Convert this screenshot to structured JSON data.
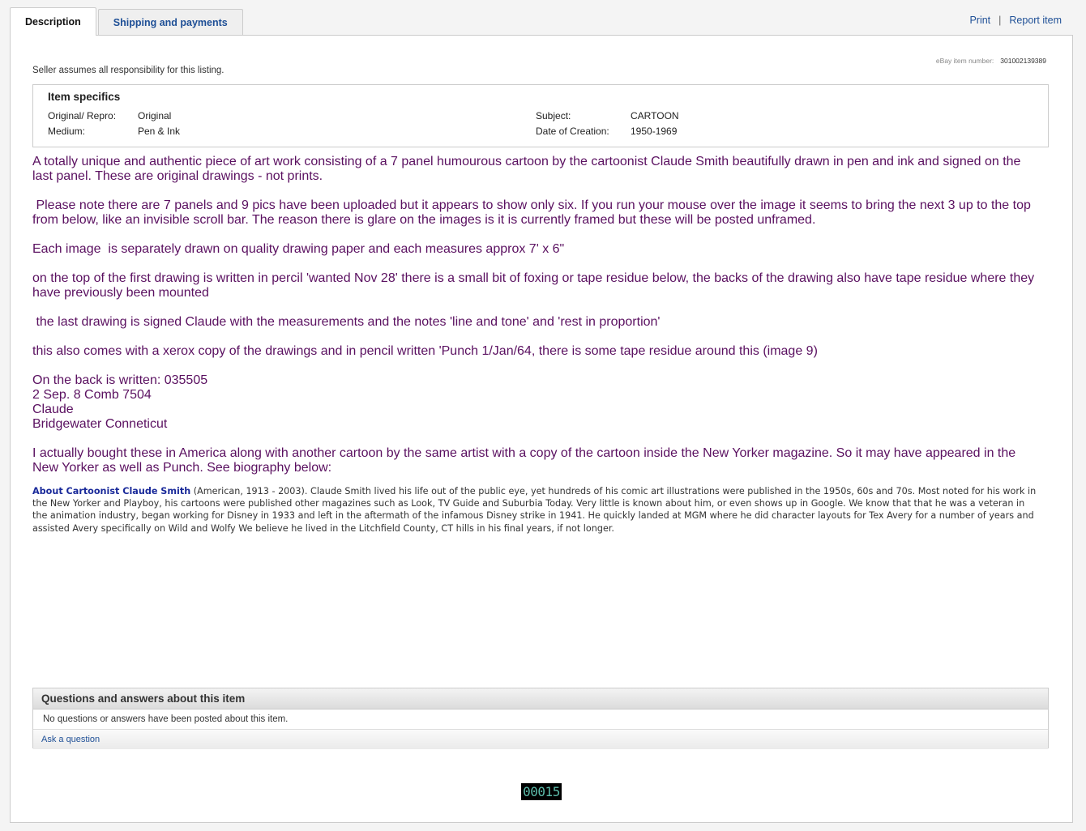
{
  "tabs": [
    {
      "label": "Description"
    },
    {
      "label": "Shipping and payments"
    }
  ],
  "toplinks": {
    "print": "Print",
    "separator": "|",
    "report": "Report item"
  },
  "item_number": {
    "label": "eBay item number:",
    "value": "301002139389"
  },
  "seller_note": "Seller assumes all responsibility for this listing.",
  "specifics": {
    "title": "Item specifics",
    "rows": [
      {
        "key": "Original/ Repro:",
        "value": "Original"
      },
      {
        "key": "Medium:",
        "value": "Pen & Ink"
      },
      {
        "key": "Subject:",
        "value": "CARTOON"
      },
      {
        "key": "Date of Creation:",
        "value": "1950-1969"
      }
    ]
  },
  "description": [
    "A totally unique and authentic piece of art work consisting of a 7 panel humourous cartoon by the cartoonist Claude Smith beautifully drawn in pen and ink and signed on the last panel. These are original drawings - not prints.",
    " Please note there are 7 panels and 9 pics have been uploaded but it appears to show only six. If you run your mouse over the image it seems to bring the next 3 up to the top from below, like an invisible scroll bar. The reason there is glare on the images is it is currently framed but these will be posted unframed.",
    "Each image  is separately drawn on quality drawing paper and each measures approx 7' x 6\"",
    "on the top of the first drawing is written in percil 'wanted Nov 28' there is a small bit of foxing or tape residue below, the backs of the drawing also have tape residue where they have previously been mounted",
    " the last drawing is signed Claude with the measurements and the notes 'line and tone' and 'rest in proportion'",
    "this also comes with a xerox copy of the drawings and in pencil written 'Punch 1/Jan/64, there is some tape residue around this (image 9)",
    "On the back is written: 035505",
    "2 Sep. 8 Comb 7504",
    "Claude",
    "Bridgewater Conneticut",
    "I actually bought these in America along with another cartoon by the same artist with a copy of the cartoon inside the New Yorker magazine. So it may have appeared in the New Yorker as well as Punch. See biography below:"
  ],
  "bio": {
    "name": "About Cartoonist Claude Smith",
    "text": " (American, 1913 - 2003). Claude Smith lived his life out of the public eye, yet hundreds of his comic art illustrations were published in the 1950s, 60s and 70s. Most noted for his work in the New Yorker and Playboy, his cartoons were published other magazines such as Look, TV Guide and Suburbia Today.  Very little is known about him, or even shows up in Google.  We know that that he was a veteran in the animation industry, began working for Disney in 1933 and left in the aftermath of the infamous Disney strike in 1941. He quickly landed at MGM where he did character layouts for Tex Avery for a number of years and assisted Avery specifically on Wild and Wolfy  We believe he lived in the Litchfield County, CT hills in his final years, if not longer."
  },
  "qa": {
    "title": "Questions and answers about this item",
    "empty": "No questions or answers have been posted about this item.",
    "ask": "Ask a question"
  },
  "counter": "00015"
}
